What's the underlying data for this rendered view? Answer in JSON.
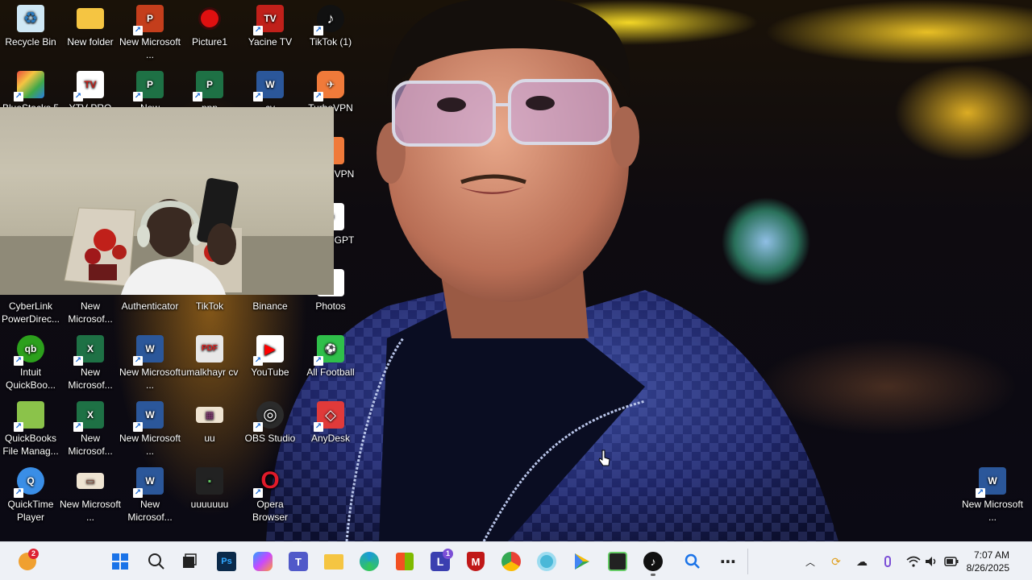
{
  "desktop_icons": [
    {
      "label": "Recycle Bin",
      "color": "#cfe8f5",
      "glyph": "♻"
    },
    {
      "label": "New folder",
      "color": "#f5c542",
      "glyph": ""
    },
    {
      "label": "New Microsoft ...",
      "color": "#c43e1c",
      "glyph": "P"
    },
    {
      "label": "Picture1",
      "color": "#e01010",
      "glyph": ""
    },
    {
      "label": "Yacine TV",
      "color": "#c0201a",
      "glyph": "TV"
    },
    {
      "label": "TikTok (1)",
      "color": "#111111",
      "glyph": "♪"
    },
    {
      "label": "BlueStacks 5",
      "color": "#3fa84a",
      "glyph": "◆"
    },
    {
      "label": "YTV PRO",
      "color": "#ffffff",
      "glyph": "TV"
    },
    {
      "label": "New",
      "color": "#1e7145",
      "glyph": "P"
    },
    {
      "label": "ppp",
      "color": "#1e7145",
      "glyph": "P"
    },
    {
      "label": "cv",
      "color": "#2b579a",
      "glyph": "W"
    },
    {
      "label": "TurboVPN",
      "color": "#f07a3a",
      "glyph": "✈"
    },
    {
      "label": "VPN",
      "color": "#f07a3a",
      "glyph": ""
    },
    {
      "label": "GPT",
      "color": "#ffffff",
      "glyph": "⚙"
    },
    {
      "label": "CyberLink PowerDirec...",
      "color": "#2a6fbf",
      "glyph": ""
    },
    {
      "label": "New Microsof...",
      "color": "#1e7145",
      "glyph": ""
    },
    {
      "label": "Authenticator",
      "color": "#2d6fd6",
      "glyph": ""
    },
    {
      "label": "TikTok",
      "color": "#111111",
      "glyph": ""
    },
    {
      "label": "Binance",
      "color": "#f0b90b",
      "glyph": ""
    },
    {
      "label": "Photos",
      "color": "#ffffff",
      "glyph": ""
    },
    {
      "label": "Intuit QuickBoo...",
      "color": "#2ca01c",
      "glyph": "qb"
    },
    {
      "label": "New Microsof...",
      "color": "#1e7145",
      "glyph": "X"
    },
    {
      "label": "New Microsoft ...",
      "color": "#2b579a",
      "glyph": "W"
    },
    {
      "label": "umalkhayr cv",
      "color": "#e8e8e8",
      "glyph": "PDF"
    },
    {
      "label": "YouTube",
      "color": "#ff0000",
      "glyph": "▶"
    },
    {
      "label": "All Football",
      "color": "#2fbf4a",
      "glyph": "⚽"
    },
    {
      "label": "QuickBooks File Manag...",
      "color": "#8bc34a",
      "glyph": ""
    },
    {
      "label": "New Microsof...",
      "color": "#1e7145",
      "glyph": "X"
    },
    {
      "label": "New Microsoft ...",
      "color": "#2b579a",
      "glyph": "W"
    },
    {
      "label": "uu",
      "color": "#efe4d2",
      "glyph": "▦"
    },
    {
      "label": "OBS Studio",
      "color": "#2b2b2b",
      "glyph": "◎"
    },
    {
      "label": "AnyDesk",
      "color": "#e03a3a",
      "glyph": "◇"
    },
    {
      "label": "QuickTime Player",
      "color": "#3a8ee6",
      "glyph": "Q"
    },
    {
      "label": "New Microsoft ...",
      "color": "#efe4d2",
      "glyph": "▭"
    },
    {
      "label": "New Microsof...",
      "color": "#2b579a",
      "glyph": "W"
    },
    {
      "label": "uuuuuuu",
      "color": "#222222",
      "glyph": "▪"
    },
    {
      "label": "Opera Browser",
      "color": "#ffffff",
      "glyph": "O"
    },
    {
      "label": "New Microsoft ...",
      "color": "#2b579a",
      "glyph": "W"
    }
  ],
  "taskbar": {
    "weather_badge": "2",
    "teams_badge": "",
    "l_badge": "1",
    "apps": [
      {
        "name": "start",
        "glyph": "⊞",
        "color": "#1a73e8"
      },
      {
        "name": "search",
        "glyph": "⌕",
        "color": "#333333"
      },
      {
        "name": "task-view",
        "glyph": "▣",
        "color": "#333333"
      },
      {
        "name": "photoshop",
        "glyph": "Ps",
        "color": "#0b2a4a"
      },
      {
        "name": "copilot",
        "glyph": "✦",
        "color": "#8a5cf6"
      },
      {
        "name": "teams",
        "glyph": "T",
        "color": "#5059c9"
      },
      {
        "name": "file-explorer",
        "glyph": "▬",
        "color": "#f5c542"
      },
      {
        "name": "edge",
        "glyph": "e",
        "color": "#1a9bd7"
      },
      {
        "name": "store",
        "glyph": "▦",
        "color": "#2a7de1"
      },
      {
        "name": "l-app",
        "glyph": "L",
        "color": "#3a3fb0"
      },
      {
        "name": "mcafee",
        "glyph": "M",
        "color": "#c01818"
      },
      {
        "name": "chrome",
        "glyph": "●",
        "color": "#e9ab17"
      },
      {
        "name": "app-circle",
        "glyph": "◉",
        "color": "#4ab8d8"
      },
      {
        "name": "play-store",
        "glyph": "▶",
        "color": "#34a853"
      },
      {
        "name": "app-dark",
        "glyph": "▦",
        "color": "#222222"
      },
      {
        "name": "tiktok",
        "glyph": "♪",
        "color": "#111111"
      },
      {
        "name": "search-app",
        "glyph": "⌕",
        "color": "#1a73e8"
      },
      {
        "name": "more",
        "glyph": "⋯",
        "color": "#333333"
      }
    ],
    "tray": {
      "chevron": "^",
      "sync": "⟳",
      "cloud": "☁",
      "mic": "🎙",
      "wifi": "⌔",
      "volume": "🔊",
      "battery": "▭"
    },
    "time": "7:07 AM",
    "date": "8/26/2025"
  }
}
